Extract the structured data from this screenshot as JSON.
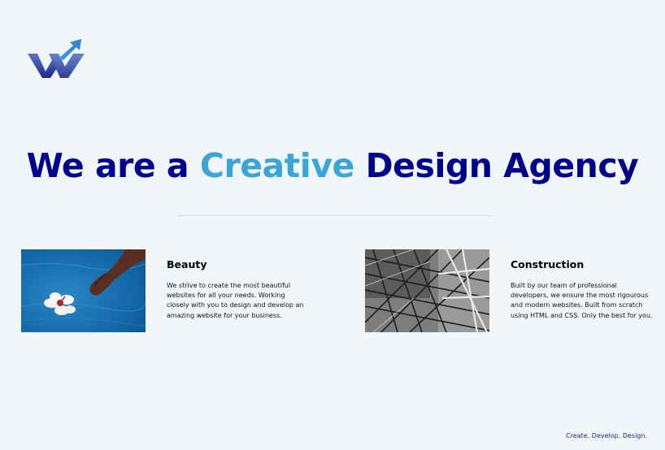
{
  "header": {
    "logo_icon": "w-arrow-logo-icon"
  },
  "hero": {
    "title_part1": "We are a ",
    "title_accent": "Creative",
    "title_part2": " Design Agency",
    "colors": {
      "primary": "#00008f",
      "accent": "#3aa6d8"
    }
  },
  "features": {
    "beauty": {
      "image": "hand-flower-water-image",
      "title": "Beauty",
      "text": "We strive to create the most beautiful websites for all your needs. Working closely with you to design and develop an amazing website for your business."
    },
    "construction": {
      "image": "steel-structure-image",
      "title": "Construction",
      "text": "Built by our team of professional developers, we ensure the most rigourous and modern websites. Built from scratch using HTML and CSS. Only the best for you."
    }
  },
  "footer": {
    "tagline": "Create. Develop. Design."
  }
}
